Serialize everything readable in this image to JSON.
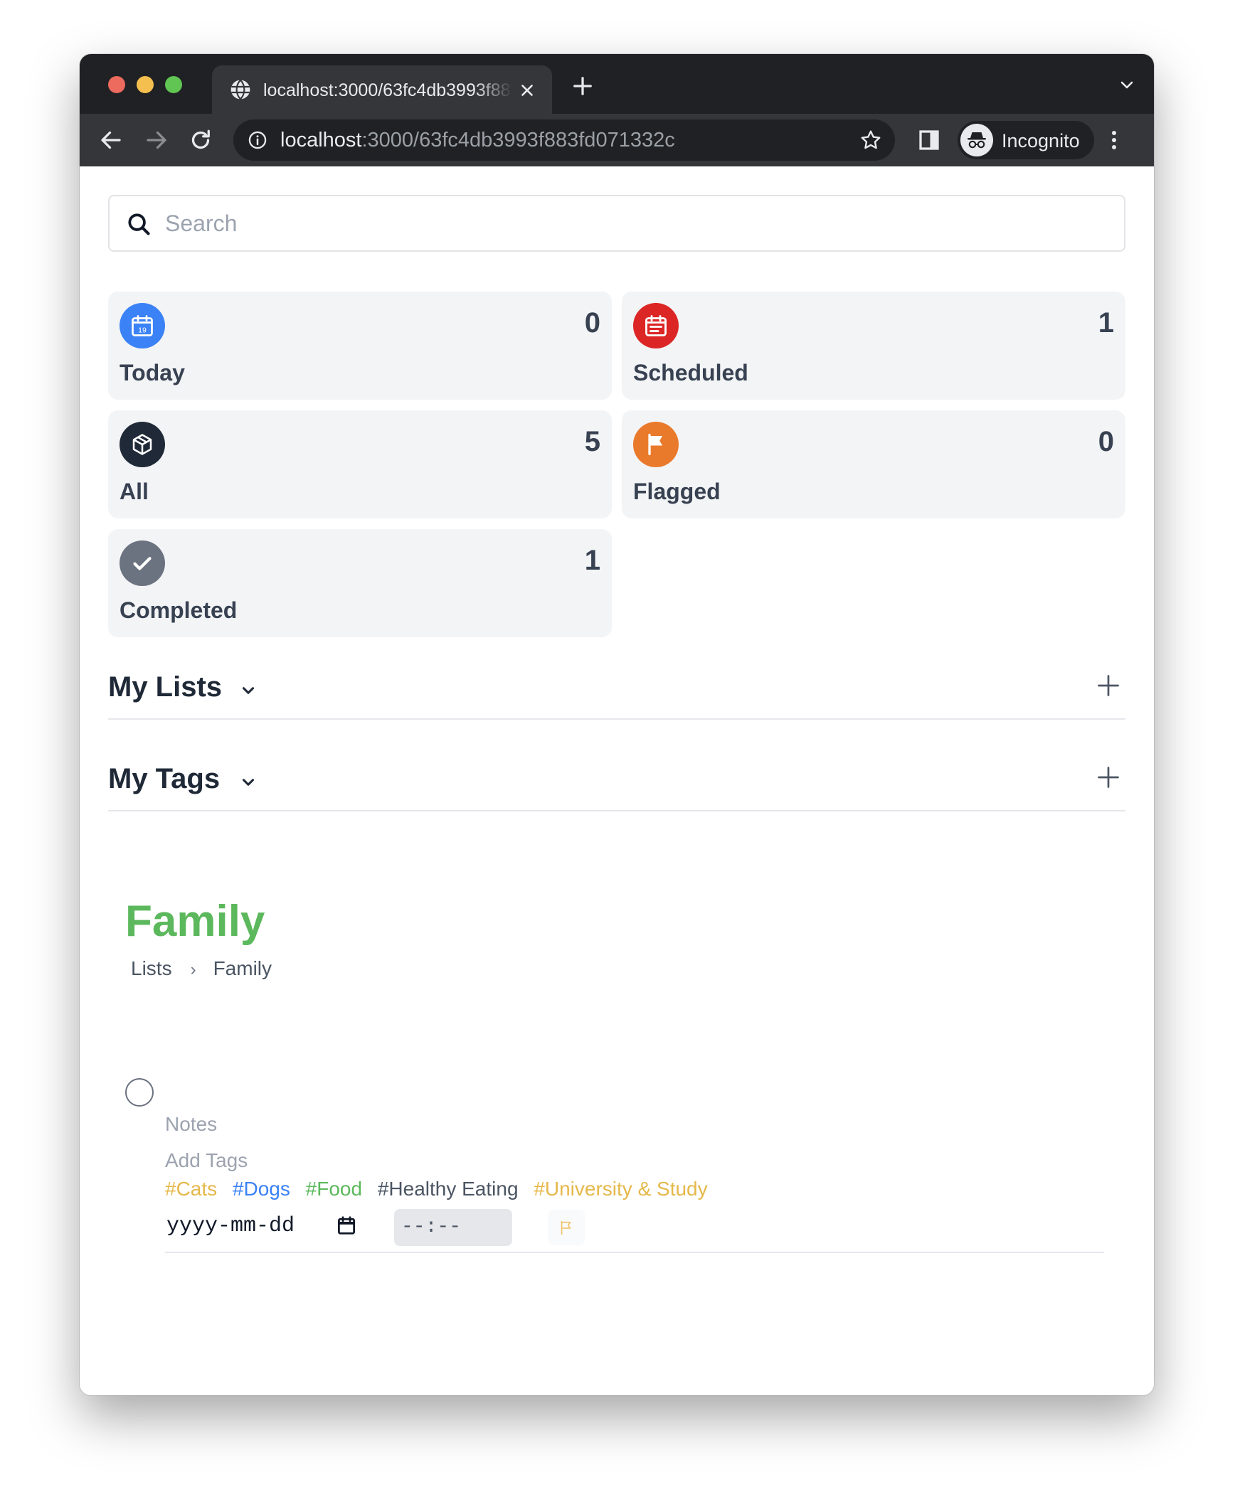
{
  "browser": {
    "tab_title": "localhost:3000/63fc4db3993f883fd071332c",
    "url_host": "localhost",
    "url_path": ":3000/63fc4db3993f883fd071332c",
    "profile_label": "Incognito"
  },
  "search": {
    "placeholder": "Search"
  },
  "cards": [
    {
      "label": "Today",
      "count": "0",
      "icon": "calendar-today-icon",
      "icon_text": "19",
      "color": "#3b82f6"
    },
    {
      "label": "Scheduled",
      "count": "1",
      "icon": "calendar-list-icon",
      "color": "#dc2626"
    },
    {
      "label": "All",
      "count": "5",
      "icon": "box-icon",
      "color": "#1f2937"
    },
    {
      "label": "Flagged",
      "count": "0",
      "icon": "flag-icon",
      "color": "#ea7a2b"
    },
    {
      "label": "Completed",
      "count": "1",
      "icon": "check-icon",
      "color": "#6b7280"
    }
  ],
  "sections": {
    "lists_title": "My Lists",
    "tags_title": "My Tags"
  },
  "list": {
    "title": "Family",
    "title_color": "#5cb85c",
    "breadcrumb": [
      "Lists",
      "Family"
    ],
    "breadcrumb_separator": "›"
  },
  "task": {
    "notes_placeholder": "Notes",
    "add_tags_placeholder": "Add Tags",
    "tags": [
      {
        "label": "#Cats",
        "color": "#e5b84a"
      },
      {
        "label": "#Dogs",
        "color": "#3b82f6"
      },
      {
        "label": "#Food",
        "color": "#5cb85c"
      },
      {
        "label": "#Healthy Eating",
        "color": "#4b5563"
      },
      {
        "label": "#University & Study",
        "color": "#e5b84a"
      }
    ],
    "date_placeholder": "yyyy-mm-dd",
    "time_placeholder": "--:--",
    "flag_color": "#f0c36a"
  }
}
